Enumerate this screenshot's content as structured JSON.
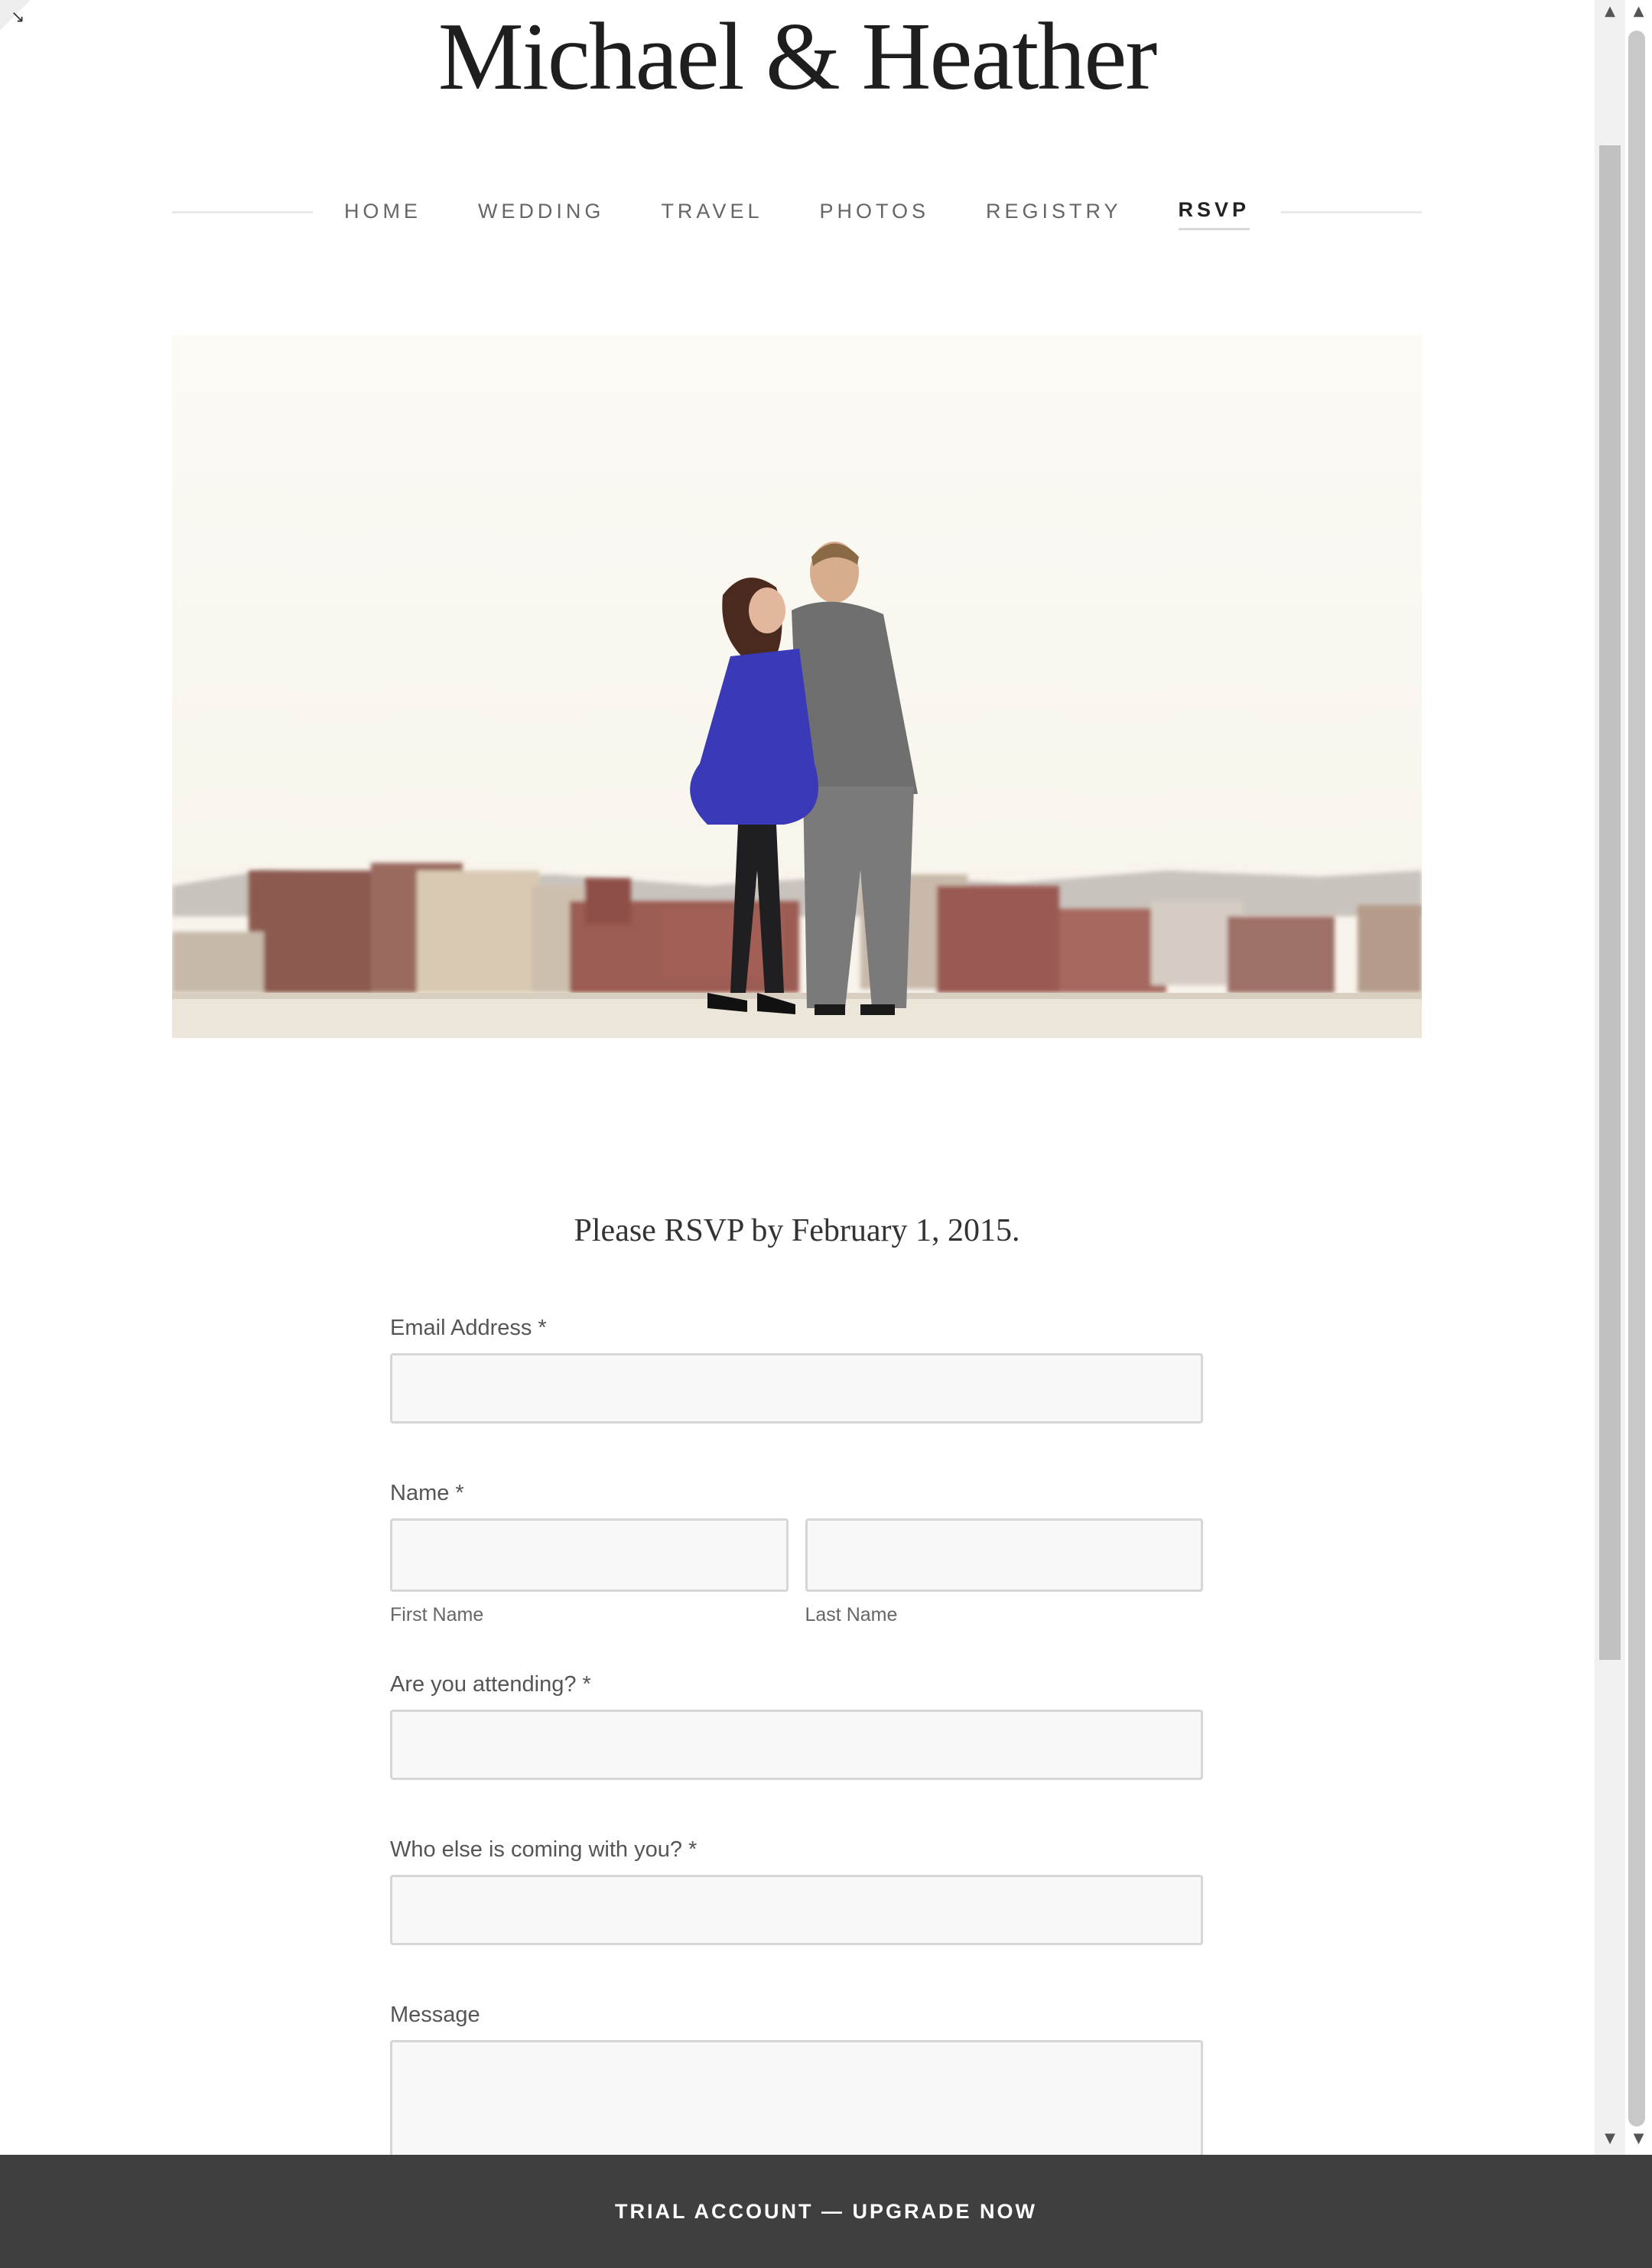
{
  "site": {
    "title": "Michael & Heather"
  },
  "nav": {
    "items": [
      {
        "label": "HOME",
        "active": false
      },
      {
        "label": "WEDDING",
        "active": false
      },
      {
        "label": "TRAVEL",
        "active": false
      },
      {
        "label": "PHOTOS",
        "active": false
      },
      {
        "label": "REGISTRY",
        "active": false
      },
      {
        "label": "RSVP",
        "active": true
      }
    ]
  },
  "hero": {
    "image_description": "couple-rooftop-photo"
  },
  "rsvp": {
    "deadline": "Please RSVP by February 1, 2015.",
    "fields": {
      "email": {
        "label": "Email Address *",
        "value": ""
      },
      "name": {
        "label": "Name *",
        "first_sublabel": "First Name",
        "last_sublabel": "Last Name",
        "first_value": "",
        "last_value": ""
      },
      "attending": {
        "label": "Are you attending? *",
        "value": ""
      },
      "guests": {
        "label": "Who else is coming with you? *",
        "value": ""
      },
      "message": {
        "label": "Message",
        "value": ""
      }
    }
  },
  "footer": {
    "banner": "TRIAL ACCOUNT — UPGRADE NOW"
  },
  "colors": {
    "footer_bg": "#3f3f3f",
    "input_bg": "#f8f8f8",
    "input_border": "#d6d6d6"
  }
}
